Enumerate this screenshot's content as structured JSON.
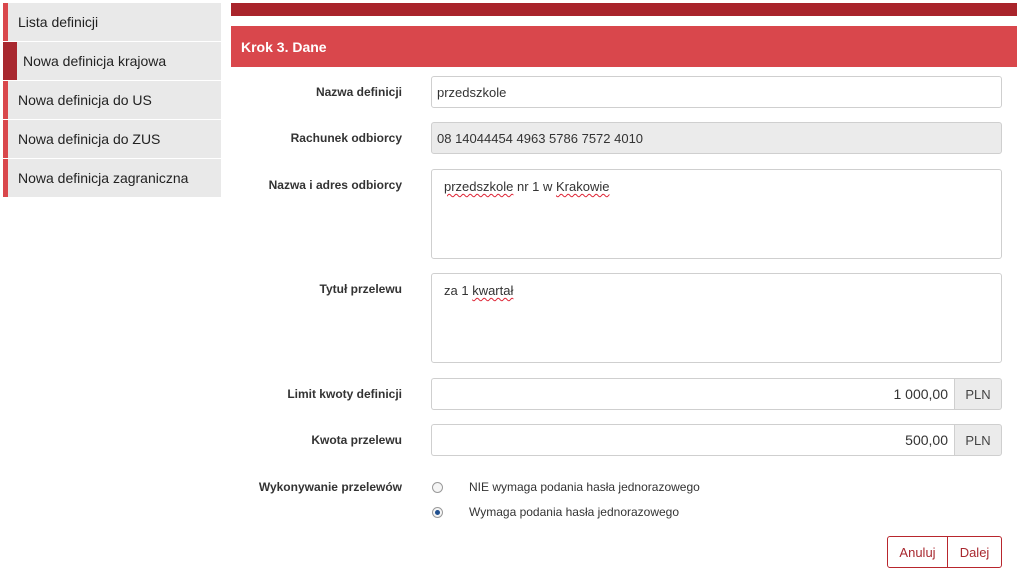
{
  "sidebar": {
    "items": [
      {
        "label": "Lista definicji",
        "active": false
      },
      {
        "label": "Nowa definicja krajowa",
        "active": true
      },
      {
        "label": "Nowa definicja do US",
        "active": false
      },
      {
        "label": "Nowa definicja do ZUS",
        "active": false
      },
      {
        "label": "Nowa definicja zagraniczna",
        "active": false
      }
    ]
  },
  "header": {
    "title": "Krok 3. Dane"
  },
  "form": {
    "name": {
      "label": "Nazwa definicji",
      "value": "przedszkole"
    },
    "account": {
      "label": "Rachunek odbiorcy",
      "value": "08 14044454 4963 5786 7572 4010"
    },
    "recipient": {
      "label": "Nazwa i adres odbiorcy",
      "value_parts": [
        "przedszkole",
        " nr 1 w ",
        "Krakowie"
      ]
    },
    "title": {
      "label": "Tytuł przelewu",
      "value_parts": [
        "za 1 ",
        "kwartał"
      ]
    },
    "limit": {
      "label": "Limit kwoty definicji",
      "value": "1 000,00",
      "currency": "PLN"
    },
    "amount": {
      "label": "Kwota przelewu",
      "value": "500,00",
      "currency": "PLN"
    },
    "execution": {
      "label": "Wykonywanie przelewów",
      "options": [
        {
          "label": "NIE wymaga podania hasła jednorazowego",
          "checked": false
        },
        {
          "label": "Wymaga podania hasła jednorazowego",
          "checked": true
        }
      ]
    }
  },
  "buttons": {
    "cancel": "Anuluj",
    "next": "Dalej"
  },
  "colors": {
    "accent": "#d9474c",
    "accent_dark": "#a9242b",
    "radio_fill": "#1f4f8f"
  }
}
